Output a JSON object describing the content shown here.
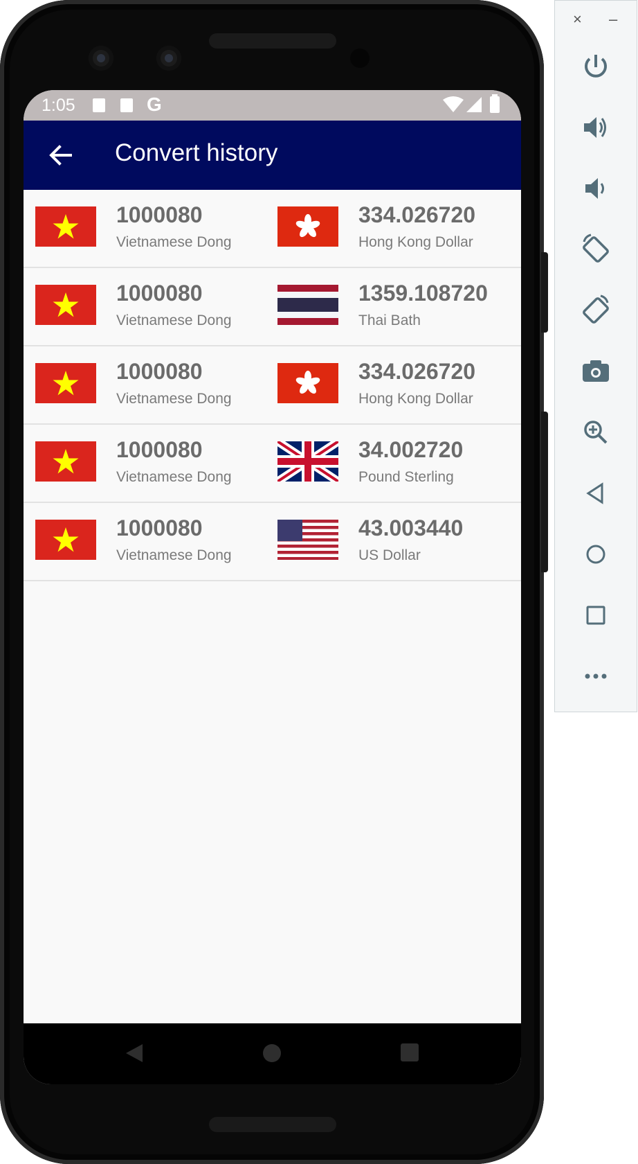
{
  "status_bar": {
    "time": "1:05",
    "carrier_glyph": "G"
  },
  "app_bar": {
    "title": "Convert history",
    "back_icon": "arrow-back-icon"
  },
  "history": [
    {
      "from_amount": "1000080",
      "from_currency": "Vietnamese Dong",
      "from_flag": "vietnam-flag-icon",
      "to_amount": "334.026720",
      "to_currency": "Hong Kong Dollar",
      "to_flag": "hong-kong-flag-icon"
    },
    {
      "from_amount": "1000080",
      "from_currency": "Vietnamese Dong",
      "from_flag": "vietnam-flag-icon",
      "to_amount": "1359.108720",
      "to_currency": "Thai Bath",
      "to_flag": "thailand-flag-icon"
    },
    {
      "from_amount": "1000080",
      "from_currency": "Vietnamese Dong",
      "from_flag": "vietnam-flag-icon",
      "to_amount": "334.026720",
      "to_currency": "Hong Kong Dollar",
      "to_flag": "hong-kong-flag-icon"
    },
    {
      "from_amount": "1000080",
      "from_currency": "Vietnamese Dong",
      "from_flag": "vietnam-flag-icon",
      "to_amount": "34.002720",
      "to_currency": "Pound Sterling",
      "to_flag": "uk-flag-icon"
    },
    {
      "from_amount": "1000080",
      "from_currency": "Vietnamese Dong",
      "from_flag": "vietnam-flag-icon",
      "to_amount": "43.003440",
      "to_currency": "US Dollar",
      "to_flag": "us-flag-icon"
    }
  ],
  "colors": {
    "app_bar": "#000a5e",
    "status_bar": "#bfb9b9",
    "amount_text": "#6b6b6b",
    "screen_bg": "#f9f9f9"
  },
  "emulator_toolbar": {
    "window_controls": [
      "close-icon",
      "minimize-icon"
    ],
    "buttons": [
      "power-icon",
      "volume-up-icon",
      "volume-down-icon",
      "rotate-left-icon",
      "rotate-right-icon",
      "camera-icon",
      "zoom-icon",
      "back-icon",
      "home-icon",
      "overview-icon",
      "more-icon"
    ],
    "close_glyph": "×",
    "minimize_glyph": "–"
  }
}
